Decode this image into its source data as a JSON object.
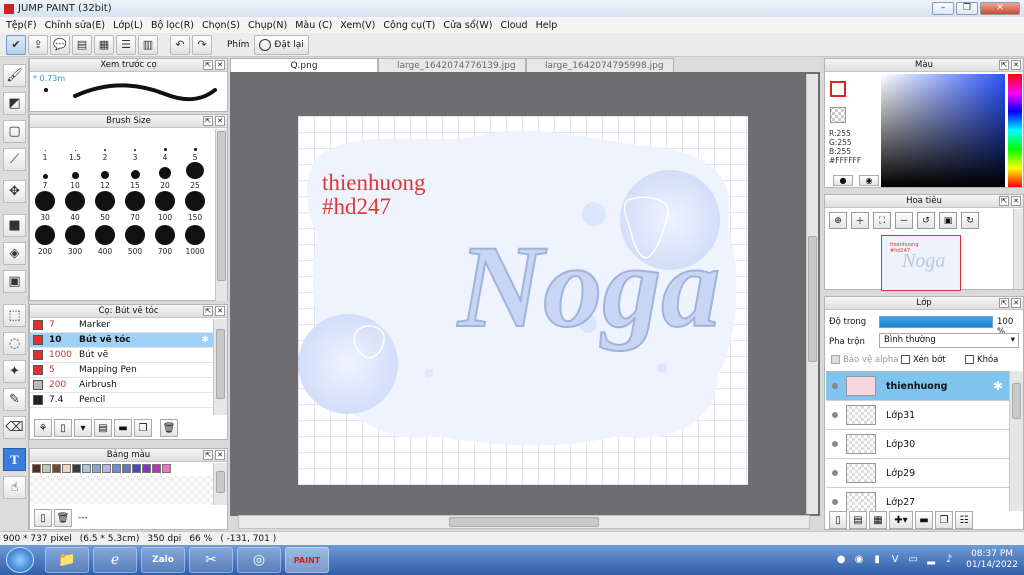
{
  "window": {
    "title": "JUMP PAINT (32bit)"
  },
  "menu": [
    "Tệp(F)",
    "Chỉnh sửa(E)",
    "Lớp(L)",
    "Bộ lọc(R)",
    "Chọn(S)",
    "Chụp(N)",
    "Màu (C)",
    "Xem(V)",
    "Công cụ(T)",
    "Cửa sổ(W)",
    "Cloud",
    "Help"
  ],
  "toolbar": {
    "keys_label": "Phím",
    "reset_label": "Đặt lại"
  },
  "preview_panel": {
    "title": "Xem trước cọ",
    "size_label": "* 0.73m"
  },
  "brushsize_panel": {
    "title": "Brush Size",
    "sizes": [
      "1",
      "1.5",
      "2",
      "3",
      "4",
      "5",
      "7",
      "10",
      "12",
      "15",
      "20",
      "25",
      "30",
      "40",
      "50",
      "70",
      "100",
      "150",
      "200",
      "300",
      "400",
      "500",
      "700",
      "1000"
    ]
  },
  "brush_panel": {
    "title": "Cọ: Bút vẽ tóc",
    "items": [
      {
        "size": "7",
        "name": "Marker",
        "color": "#e03030"
      },
      {
        "size": "10",
        "name": "Bút vẽ tóc",
        "color": "#e03030"
      },
      {
        "size": "1000",
        "name": "Bút vẽ",
        "color": "#e03030"
      },
      {
        "size": "5",
        "name": "Mapping Pen",
        "color": "#e03030"
      },
      {
        "size": "200",
        "name": "Airbrush",
        "color": "#bbbbbb"
      },
      {
        "size": "7.4",
        "name": "Pencil",
        "color": "#222222"
      }
    ]
  },
  "palette_panel": {
    "title": "Bảng màu",
    "footer": "---",
    "colors": [
      "#5a2e12",
      "#c8c4b4",
      "#7a4a2e",
      "#e8d8c0",
      "#3a3a3a",
      "#a8c8e0",
      "#88a8d0",
      "#b0b8e8",
      "#6890d8",
      "#6078c8",
      "#4848c0",
      "#8830c8",
      "#c030c0",
      "#ff70c0"
    ]
  },
  "tabs": [
    "Q.png",
    "large_1642074776139.jpg",
    "large_1642074795998.jpg"
  ],
  "artwork": {
    "line1": "thienhuong",
    "line2": "#hd247",
    "word": "Noga"
  },
  "color_panel": {
    "title": "Màu",
    "r": "R:255",
    "g": "G:255",
    "b": "B:255",
    "hex": "#FFFFFF"
  },
  "navigator_panel": {
    "title": "Hoa tiêu"
  },
  "layer_panel": {
    "title": "Lớp",
    "opacity_label": "Độ trong",
    "opacity_value": "100 %",
    "opacity_fraction": 1.0,
    "blend_label": "Pha trộn",
    "blend_value": "Bình thường",
    "protect_alpha": "Bảo vệ alpha",
    "clip": "Xén bớt",
    "lock": "Khóa",
    "layers": [
      "thienhuong",
      "Lớp31",
      "Lớp30",
      "Lớp29",
      "Lớp27"
    ]
  },
  "status": {
    "dims": "900 * 737 pixel",
    "size": "(6.5 * 5.3cm)",
    "dpi": "350 dpi",
    "zoom": "66 %",
    "coords": "( -131, 701 )"
  },
  "taskbar": {
    "time": "08:37 PM",
    "date": "01/14/2022",
    "apps": [
      "folder",
      "ie",
      "zalo",
      "scissors",
      "chrome",
      "jumppaint"
    ]
  }
}
